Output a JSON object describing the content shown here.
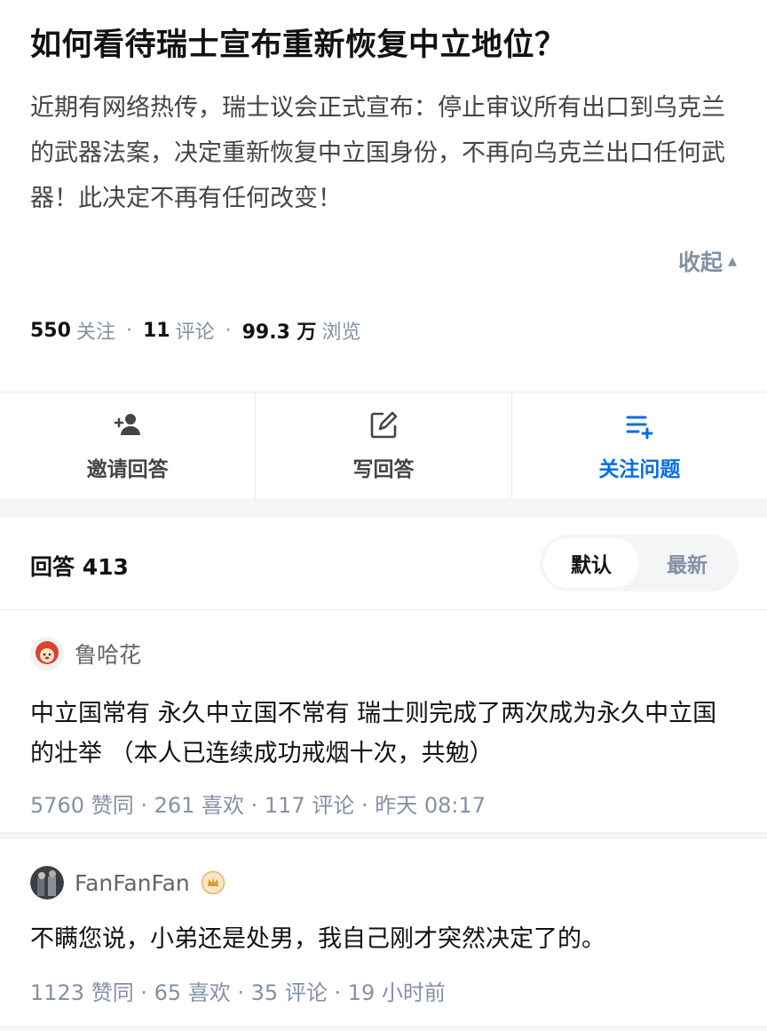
{
  "question": {
    "title": "如何看待瑞士宣布重新恢复中立地位？",
    "description": "近期有网络热传，瑞士议会正式宣布：停止审议所有出口到乌克兰的武器法案，决定重新恢复中立国身份，不再向乌克兰出口任何武器！此决定不再有任何改变！",
    "collapse_label": "收起",
    "stats": {
      "followers_num": "550",
      "followers_label": "关注",
      "comments_num": "11",
      "comments_label": "评论",
      "views_num": "99.3 万",
      "views_label": "浏览"
    }
  },
  "actions": [
    {
      "label": "邀请回答",
      "icon": "invite-user-icon"
    },
    {
      "label": "写回答",
      "icon": "edit-icon"
    },
    {
      "label": "关注问题",
      "icon": "follow-list-icon"
    }
  ],
  "colors": {
    "accent": "#056de8",
    "muted": "#8590a6",
    "divider": "#ebebeb",
    "gap": "#f4f5f7"
  },
  "answers_header": {
    "title": "回答 413",
    "sort_options": [
      "默认",
      "最新"
    ],
    "selected_sort": "默认"
  },
  "answers": [
    {
      "author": "鲁哈花",
      "body": "中立国常有 永久中立国不常有 瑞士则完成了两次成为永久中立国的壮举 （本人已连续成功戒烟十次，共勉）",
      "meta": "5760 赞同 · 261 喜欢 · 117 评论 · 昨天 08:17"
    },
    {
      "author": "FanFanFan",
      "badge_icon": "crown-badge-icon",
      "body": "不瞒您说，小弟还是处男，我自己刚才突然决定了的。",
      "meta": "1123 赞同 · 65 喜欢 · 35 评论 · 19 小时前"
    }
  ]
}
